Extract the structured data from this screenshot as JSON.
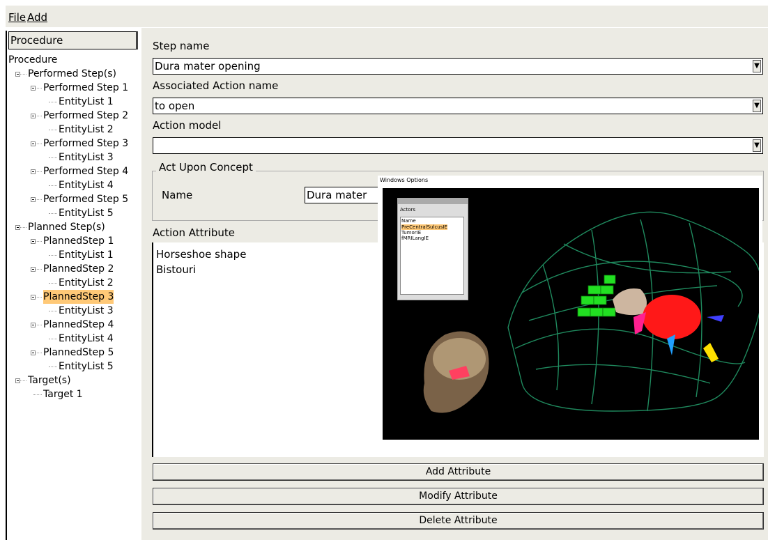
{
  "menubar": {
    "items": [
      "File",
      "Add"
    ]
  },
  "tree": {
    "header": "Procedure",
    "nodes": [
      "Procedure",
      "Performed Step(s)",
      "Performed Step 1",
      "EntityList 1",
      "Performed Step 2",
      "EntityList 2",
      "Performed Step 3",
      "EntityList 3",
      "Performed Step 4",
      "EntityList 4",
      "Performed Step 5",
      "EntityList 5",
      "Planned Step(s)",
      "PlannedStep 1",
      "EntityList 1",
      "PlannedStep 2",
      "EntityList 2",
      "PlannedStep 3",
      "EntityList 3",
      "PlannedStep 4",
      "EntityList 4",
      "PlannedStep 5",
      "EntityList 5",
      "Target(s)",
      "Target 1"
    ],
    "selected": "PlannedStep 3"
  },
  "form": {
    "step_name_label": "Step name",
    "step_name_value": "Dura mater opening",
    "action_name_label": "Associated Action name",
    "action_name_value": "to open",
    "action_model_label": "Action model",
    "action_model_value": "",
    "act_upon_title": "Act Upon Concept",
    "name_label": "Name",
    "name_value": "Dura mater",
    "attr_label": "Action Attribute",
    "attributes": [
      "Horseshoe shape",
      "Bistouri"
    ]
  },
  "buttons": {
    "add": "Add Attribute",
    "modify": "Modify Attribute",
    "delete": "Delete Attribute"
  },
  "viewer": {
    "menu": "Windows  Options",
    "actors_title": "Actors",
    "actors_window_title": "Actors",
    "column": "Name",
    "actors": [
      "PreCentralSulcusIE",
      "TumorIE",
      "fMRILangIE"
    ],
    "selected_actor": "PreCentralSulcusIE"
  }
}
